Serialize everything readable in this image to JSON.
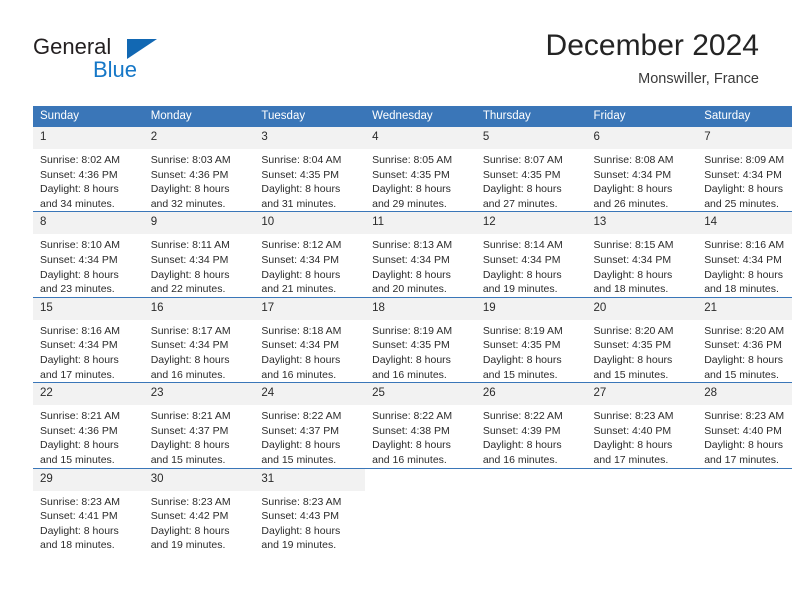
{
  "brand": {
    "name_top": "General",
    "name_bottom": "Blue",
    "triangle_color": "#1268b3",
    "bottom_color": "#1577c7"
  },
  "header": {
    "title": "December 2024",
    "subtitle": "Monswiller, France"
  },
  "theme": {
    "header_bg": "#3a76b8",
    "daynum_bg": "#f2f2f2",
    "grid_line": "#3a76b8",
    "text": "#2b2b2b"
  },
  "weekday_headers": [
    "Sunday",
    "Monday",
    "Tuesday",
    "Wednesday",
    "Thursday",
    "Friday",
    "Saturday"
  ],
  "weeks": [
    [
      {
        "day": "1",
        "sunrise": "Sunrise: 8:02 AM",
        "sunset": "Sunset: 4:36 PM",
        "daylight1": "Daylight: 8 hours",
        "daylight2": "and 34 minutes."
      },
      {
        "day": "2",
        "sunrise": "Sunrise: 8:03 AM",
        "sunset": "Sunset: 4:36 PM",
        "daylight1": "Daylight: 8 hours",
        "daylight2": "and 32 minutes."
      },
      {
        "day": "3",
        "sunrise": "Sunrise: 8:04 AM",
        "sunset": "Sunset: 4:35 PM",
        "daylight1": "Daylight: 8 hours",
        "daylight2": "and 31 minutes."
      },
      {
        "day": "4",
        "sunrise": "Sunrise: 8:05 AM",
        "sunset": "Sunset: 4:35 PM",
        "daylight1": "Daylight: 8 hours",
        "daylight2": "and 29 minutes."
      },
      {
        "day": "5",
        "sunrise": "Sunrise: 8:07 AM",
        "sunset": "Sunset: 4:35 PM",
        "daylight1": "Daylight: 8 hours",
        "daylight2": "and 27 minutes."
      },
      {
        "day": "6",
        "sunrise": "Sunrise: 8:08 AM",
        "sunset": "Sunset: 4:34 PM",
        "daylight1": "Daylight: 8 hours",
        "daylight2": "and 26 minutes."
      },
      {
        "day": "7",
        "sunrise": "Sunrise: 8:09 AM",
        "sunset": "Sunset: 4:34 PM",
        "daylight1": "Daylight: 8 hours",
        "daylight2": "and 25 minutes."
      }
    ],
    [
      {
        "day": "8",
        "sunrise": "Sunrise: 8:10 AM",
        "sunset": "Sunset: 4:34 PM",
        "daylight1": "Daylight: 8 hours",
        "daylight2": "and 23 minutes."
      },
      {
        "day": "9",
        "sunrise": "Sunrise: 8:11 AM",
        "sunset": "Sunset: 4:34 PM",
        "daylight1": "Daylight: 8 hours",
        "daylight2": "and 22 minutes."
      },
      {
        "day": "10",
        "sunrise": "Sunrise: 8:12 AM",
        "sunset": "Sunset: 4:34 PM",
        "daylight1": "Daylight: 8 hours",
        "daylight2": "and 21 minutes."
      },
      {
        "day": "11",
        "sunrise": "Sunrise: 8:13 AM",
        "sunset": "Sunset: 4:34 PM",
        "daylight1": "Daylight: 8 hours",
        "daylight2": "and 20 minutes."
      },
      {
        "day": "12",
        "sunrise": "Sunrise: 8:14 AM",
        "sunset": "Sunset: 4:34 PM",
        "daylight1": "Daylight: 8 hours",
        "daylight2": "and 19 minutes."
      },
      {
        "day": "13",
        "sunrise": "Sunrise: 8:15 AM",
        "sunset": "Sunset: 4:34 PM",
        "daylight1": "Daylight: 8 hours",
        "daylight2": "and 18 minutes."
      },
      {
        "day": "14",
        "sunrise": "Sunrise: 8:16 AM",
        "sunset": "Sunset: 4:34 PM",
        "daylight1": "Daylight: 8 hours",
        "daylight2": "and 18 minutes."
      }
    ],
    [
      {
        "day": "15",
        "sunrise": "Sunrise: 8:16 AM",
        "sunset": "Sunset: 4:34 PM",
        "daylight1": "Daylight: 8 hours",
        "daylight2": "and 17 minutes."
      },
      {
        "day": "16",
        "sunrise": "Sunrise: 8:17 AM",
        "sunset": "Sunset: 4:34 PM",
        "daylight1": "Daylight: 8 hours",
        "daylight2": "and 16 minutes."
      },
      {
        "day": "17",
        "sunrise": "Sunrise: 8:18 AM",
        "sunset": "Sunset: 4:34 PM",
        "daylight1": "Daylight: 8 hours",
        "daylight2": "and 16 minutes."
      },
      {
        "day": "18",
        "sunrise": "Sunrise: 8:19 AM",
        "sunset": "Sunset: 4:35 PM",
        "daylight1": "Daylight: 8 hours",
        "daylight2": "and 16 minutes."
      },
      {
        "day": "19",
        "sunrise": "Sunrise: 8:19 AM",
        "sunset": "Sunset: 4:35 PM",
        "daylight1": "Daylight: 8 hours",
        "daylight2": "and 15 minutes."
      },
      {
        "day": "20",
        "sunrise": "Sunrise: 8:20 AM",
        "sunset": "Sunset: 4:35 PM",
        "daylight1": "Daylight: 8 hours",
        "daylight2": "and 15 minutes."
      },
      {
        "day": "21",
        "sunrise": "Sunrise: 8:20 AM",
        "sunset": "Sunset: 4:36 PM",
        "daylight1": "Daylight: 8 hours",
        "daylight2": "and 15 minutes."
      }
    ],
    [
      {
        "day": "22",
        "sunrise": "Sunrise: 8:21 AM",
        "sunset": "Sunset: 4:36 PM",
        "daylight1": "Daylight: 8 hours",
        "daylight2": "and 15 minutes."
      },
      {
        "day": "23",
        "sunrise": "Sunrise: 8:21 AM",
        "sunset": "Sunset: 4:37 PM",
        "daylight1": "Daylight: 8 hours",
        "daylight2": "and 15 minutes."
      },
      {
        "day": "24",
        "sunrise": "Sunrise: 8:22 AM",
        "sunset": "Sunset: 4:37 PM",
        "daylight1": "Daylight: 8 hours",
        "daylight2": "and 15 minutes."
      },
      {
        "day": "25",
        "sunrise": "Sunrise: 8:22 AM",
        "sunset": "Sunset: 4:38 PM",
        "daylight1": "Daylight: 8 hours",
        "daylight2": "and 16 minutes."
      },
      {
        "day": "26",
        "sunrise": "Sunrise: 8:22 AM",
        "sunset": "Sunset: 4:39 PM",
        "daylight1": "Daylight: 8 hours",
        "daylight2": "and 16 minutes."
      },
      {
        "day": "27",
        "sunrise": "Sunrise: 8:23 AM",
        "sunset": "Sunset: 4:40 PM",
        "daylight1": "Daylight: 8 hours",
        "daylight2": "and 17 minutes."
      },
      {
        "day": "28",
        "sunrise": "Sunrise: 8:23 AM",
        "sunset": "Sunset: 4:40 PM",
        "daylight1": "Daylight: 8 hours",
        "daylight2": "and 17 minutes."
      }
    ],
    [
      {
        "day": "29",
        "sunrise": "Sunrise: 8:23 AM",
        "sunset": "Sunset: 4:41 PM",
        "daylight1": "Daylight: 8 hours",
        "daylight2": "and 18 minutes."
      },
      {
        "day": "30",
        "sunrise": "Sunrise: 8:23 AM",
        "sunset": "Sunset: 4:42 PM",
        "daylight1": "Daylight: 8 hours",
        "daylight2": "and 19 minutes."
      },
      {
        "day": "31",
        "sunrise": "Sunrise: 8:23 AM",
        "sunset": "Sunset: 4:43 PM",
        "daylight1": "Daylight: 8 hours",
        "daylight2": "and 19 minutes."
      },
      {
        "day": "",
        "sunrise": "",
        "sunset": "",
        "daylight1": "",
        "daylight2": ""
      },
      {
        "day": "",
        "sunrise": "",
        "sunset": "",
        "daylight1": "",
        "daylight2": ""
      },
      {
        "day": "",
        "sunrise": "",
        "sunset": "",
        "daylight1": "",
        "daylight2": ""
      },
      {
        "day": "",
        "sunrise": "",
        "sunset": "",
        "daylight1": "",
        "daylight2": ""
      }
    ]
  ]
}
